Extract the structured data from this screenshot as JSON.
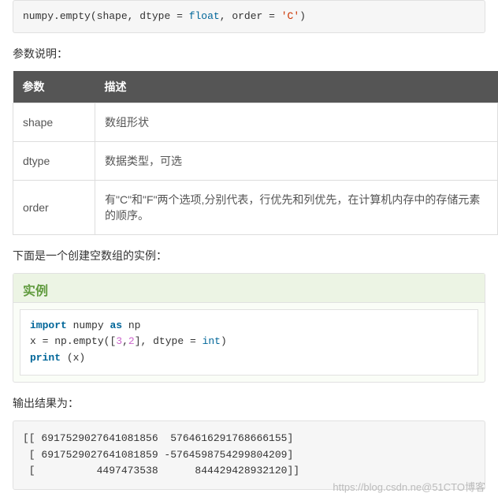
{
  "signature": {
    "prefix": "numpy",
    "func": "empty",
    "args": "shape",
    "dtype_kw": "dtype",
    "float_kw": "float",
    "order_kw": "order",
    "order_val": "'C'"
  },
  "params_heading": "参数说明：",
  "table": {
    "headers": {
      "param": "参数",
      "desc": "描述"
    },
    "rows": [
      {
        "param": "shape",
        "desc": "数组形状"
      },
      {
        "param": "dtype",
        "desc": "数据类型，可选"
      },
      {
        "param": "order",
        "desc": "有\"C\"和\"F\"两个选项,分别代表，行优先和列优先，在计算机内存中的存储元素的顺序。"
      }
    ]
  },
  "example_intro": "下面是一个创建空数组的实例：",
  "example": {
    "title": "实例",
    "line1": {
      "import": "import",
      "numpy": "numpy",
      "as": "as",
      "np": "np"
    },
    "line2": {
      "x_eq": "x = np",
      "empty": "empty",
      "open": "([",
      "n1": "3",
      "comma1": ",",
      "n2": "2",
      "close_br": "],",
      "dtype_kw": "dtype",
      "eq": "=",
      "int_kw": "int",
      "close": ")"
    },
    "line3": {
      "print": "print",
      "rest": "(x)"
    }
  },
  "output_heading": "输出结果为：",
  "output": {
    "l1": "[[ 6917529027641081856  5764616291768666155]",
    "l2": " [ 6917529027641081859 -5764598754299804209]",
    "l3": " [          4497473538      844429428932120]]"
  },
  "watermark": "https://blog.csdn.ne@51CTO博客"
}
